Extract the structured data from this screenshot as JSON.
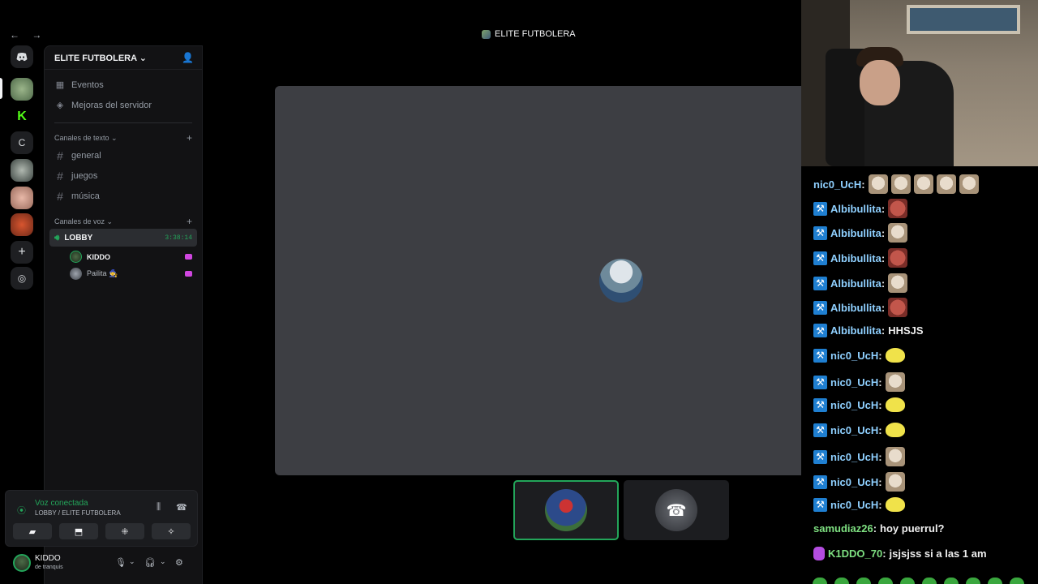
{
  "window": {
    "title": "ELITE FUTBOLERA",
    "nav": "← →"
  },
  "server": {
    "name": "ELITE FUTBOLERA",
    "chevron": "⌄",
    "menu_items": [
      {
        "icon": "calendar-icon",
        "label": "Eventos"
      },
      {
        "icon": "boost-icon",
        "label": "Mejoras del servidor"
      }
    ],
    "text_category": "Canales de texto",
    "text_channels": [
      "general",
      "juegos",
      "música"
    ],
    "voice_category": "Canales de voz",
    "voice_channel": {
      "name": "LOBBY",
      "timer": "3:38:14"
    },
    "voice_members": [
      {
        "name": "KIDDO"
      },
      {
        "name": "Pailita 🧙"
      }
    ]
  },
  "rail": {
    "letter_server": "C"
  },
  "voice_panel": {
    "status": "Voz conectada",
    "location": "LOBBY / ELITE FUTBOLERA"
  },
  "user": {
    "name": "KIDDO",
    "status": "de tranquis"
  },
  "chat": {
    "messages": [
      {
        "user": "nic0_UcH",
        "badge": false,
        "emotes": [
          "cat",
          "cat",
          "cat",
          "cat",
          "cat"
        ],
        "text": ""
      },
      {
        "user": "Albibullita",
        "badge": true,
        "emotes": [
          "red"
        ],
        "text": ""
      },
      {
        "user": "Albibullita",
        "badge": true,
        "emotes": [
          "cat"
        ],
        "text": ""
      },
      {
        "user": "Albibullita",
        "badge": true,
        "emotes": [
          "red"
        ],
        "text": ""
      },
      {
        "user": "Albibullita",
        "badge": true,
        "emotes": [
          "cat"
        ],
        "text": ""
      },
      {
        "user": "Albibullita",
        "badge": true,
        "emotes": [
          "red"
        ],
        "text": ""
      },
      {
        "user": "Albibullita",
        "badge": true,
        "emotes": [],
        "text": "HHSJS"
      },
      {
        "user": "nic0_UcH",
        "badge": true,
        "emotes": [
          "duck"
        ],
        "text": ""
      },
      {
        "user": "nic0_UcH",
        "badge": true,
        "emotes": [
          "cat"
        ],
        "text": ""
      },
      {
        "user": "nic0_UcH",
        "badge": true,
        "emotes": [
          "duck"
        ],
        "text": ""
      },
      {
        "user": "nic0_UcH",
        "badge": true,
        "emotes": [
          "duck"
        ],
        "text": ""
      },
      {
        "user": "nic0_UcH",
        "badge": true,
        "emotes": [
          "cat"
        ],
        "text": ""
      },
      {
        "user": "nic0_UcH",
        "badge": true,
        "emotes": [
          "cat"
        ],
        "text": ""
      },
      {
        "user": "nic0_UcH",
        "badge": true,
        "emotes": [
          "duck"
        ],
        "text": ""
      },
      {
        "user": "samudiaz26",
        "badge": false,
        "emotes": [],
        "text": "hoy puerrul?"
      },
      {
        "user": "K1DDO_70",
        "badge": false,
        "mic": true,
        "emotes": [],
        "text": "jsjsjss si a las 1 am"
      }
    ]
  },
  "colors": {
    "accent_green": "#23a55a",
    "chat_username_blue": "#8fd0ff",
    "chat_username_green": "#7ee081",
    "badge_blue": "#1f7fd1"
  }
}
